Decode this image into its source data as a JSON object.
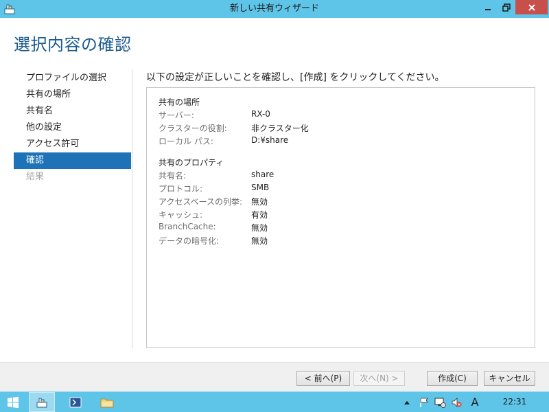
{
  "window": {
    "title": "新しい共有ウィザード"
  },
  "page": {
    "heading": "選択内容の確認",
    "instruction": "以下の設定が正しいことを確認し、[作成] をクリックしてください。"
  },
  "nav": {
    "items": [
      {
        "label": "プロファイルの選択",
        "state": "normal"
      },
      {
        "label": "共有の場所",
        "state": "normal"
      },
      {
        "label": "共有名",
        "state": "normal"
      },
      {
        "label": "他の設定",
        "state": "normal"
      },
      {
        "label": "アクセス許可",
        "state": "normal"
      },
      {
        "label": "確認",
        "state": "active"
      },
      {
        "label": "結果",
        "state": "disabled"
      }
    ]
  },
  "summary": {
    "location": {
      "title": "共有の場所",
      "rows": [
        {
          "label": "サーバー:",
          "value": "RX-0"
        },
        {
          "label": "クラスターの役割:",
          "value": "非クラスター化"
        },
        {
          "label": "ローカル パス:",
          "value": "D:¥share"
        }
      ]
    },
    "properties": {
      "title": "共有のプロパティ",
      "rows": [
        {
          "label": "共有名:",
          "value": "share"
        },
        {
          "label": "プロトコル:",
          "value": "SMB"
        },
        {
          "label": "アクセスベースの列挙:",
          "value": "無効"
        },
        {
          "label": "キャッシュ:",
          "value": "有効"
        },
        {
          "label": "BranchCache:",
          "value": "無効"
        },
        {
          "label": "データの暗号化:",
          "value": "無効"
        }
      ]
    }
  },
  "buttons": {
    "prev": "< 前へ(P)",
    "next": "次へ(N) >",
    "create": "作成(C)",
    "cancel": "キャンセル"
  },
  "taskbar": {
    "clock": "22:31",
    "ime": "A"
  },
  "colors": {
    "accent": "#1d72b8",
    "titlebar": "#5ec5e8",
    "heading": "#1a5a8e",
    "close": "#c7504b"
  }
}
